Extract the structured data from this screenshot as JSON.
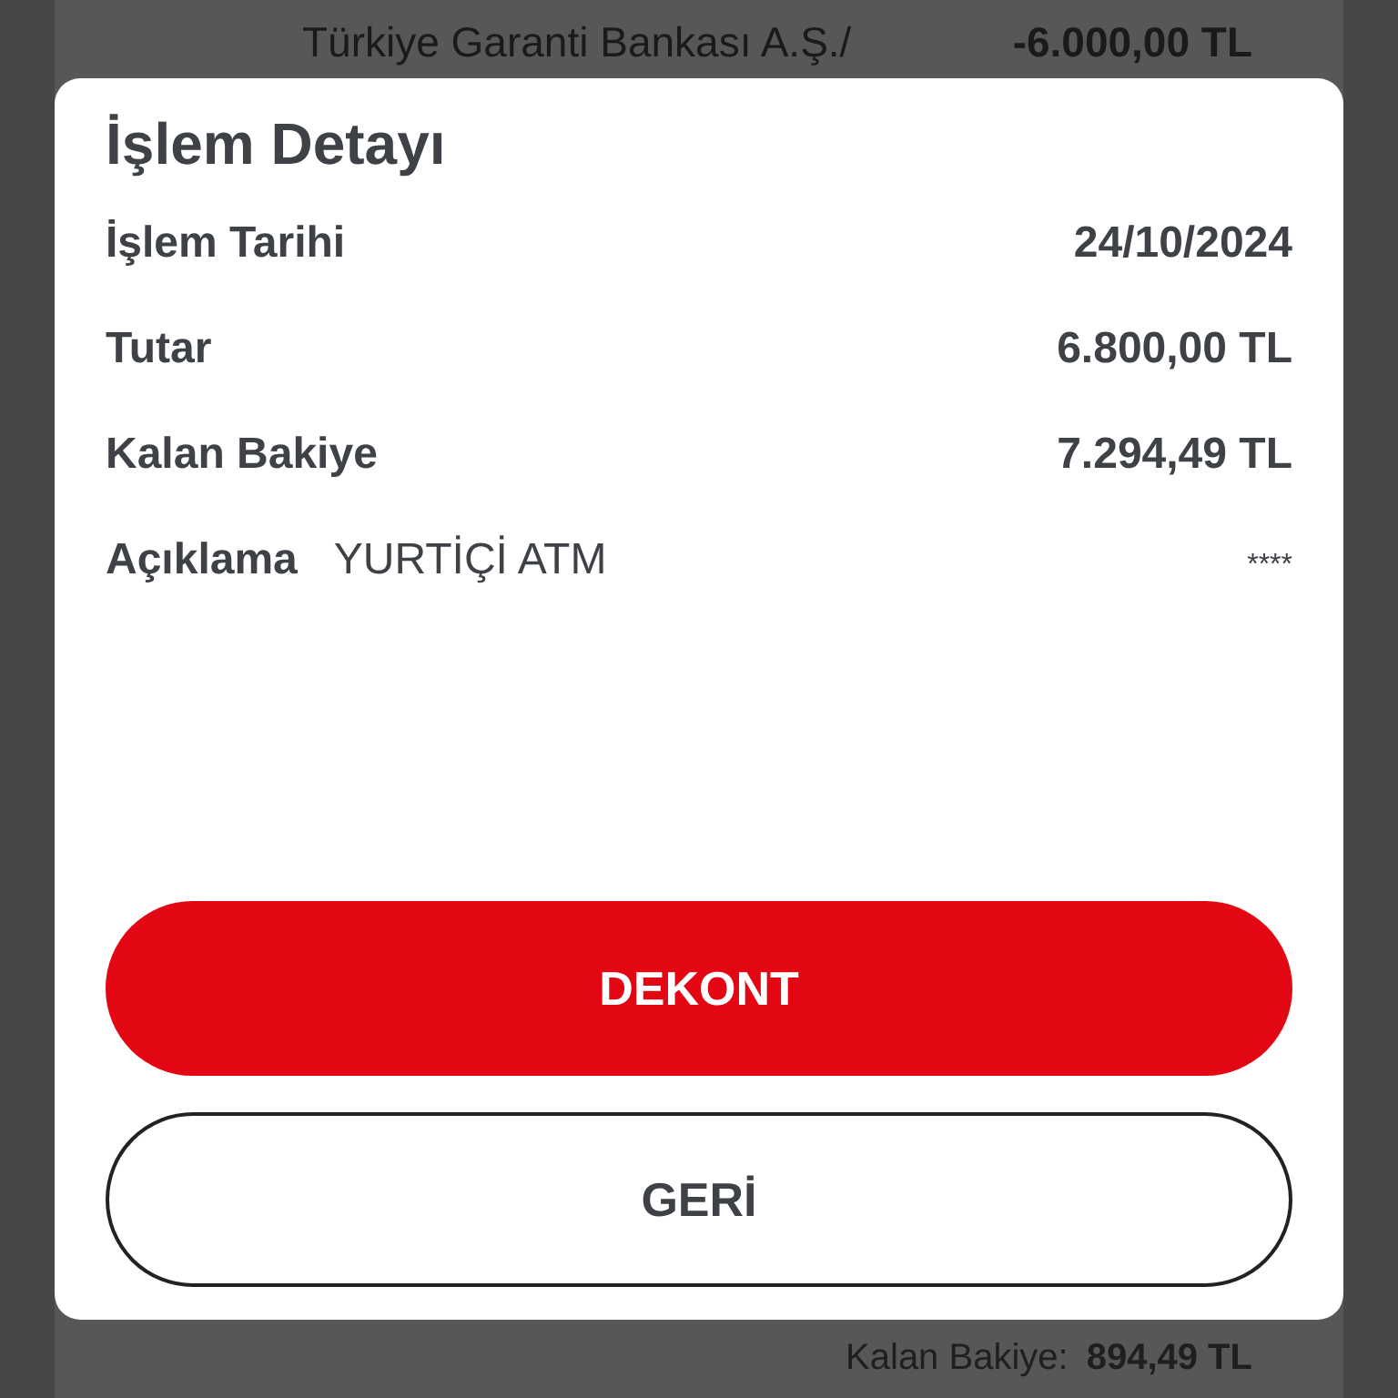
{
  "background_list": {
    "top_row": {
      "counterparty": "Türkiye Garanti Bankası A.Ş./",
      "amount": "-6.000,00 TL"
    },
    "bottom_row": {
      "label": "Kalan Bakiye:",
      "value": "894,49 TL"
    }
  },
  "dialog": {
    "title": "İşlem Detayı",
    "fields": [
      {
        "label": "İşlem Tarihi",
        "value": "24/10/2024"
      },
      {
        "label": "Tutar",
        "value": "6.800,00 TL"
      },
      {
        "label": "Kalan Bakiye",
        "value": "7.294,49 TL"
      }
    ],
    "description": {
      "label": "Açıklama",
      "value": "YURTİÇİ ATM",
      "masked": "****"
    },
    "buttons": [
      {
        "label": "DEKONT",
        "kind": "primary"
      },
      {
        "label": "GERİ",
        "kind": "secondary"
      }
    ]
  }
}
